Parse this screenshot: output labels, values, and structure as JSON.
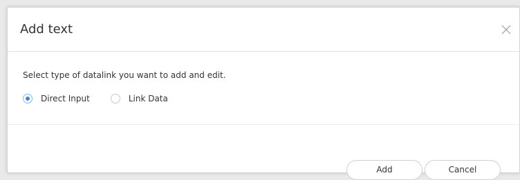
{
  "dialog": {
    "title": "Add text",
    "description": "Select type of datalink you want to add and edit.",
    "options": [
      {
        "label": "Direct Input",
        "checked": true
      },
      {
        "label": "Link Data",
        "checked": false
      }
    ],
    "buttons": {
      "add": "Add",
      "cancel": "Cancel"
    }
  },
  "colors": {
    "accent": "#3a86db",
    "text": "#333333",
    "border": "#cfcfcf"
  }
}
